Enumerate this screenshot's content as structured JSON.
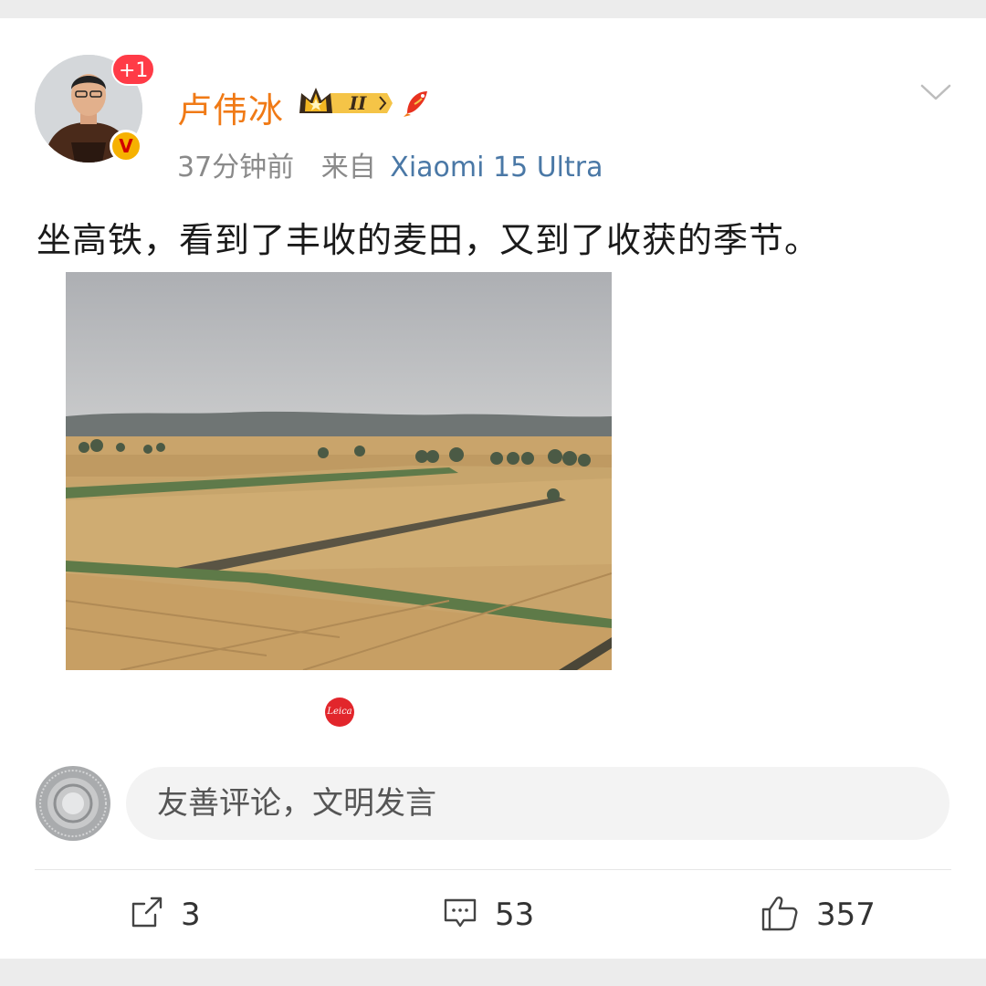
{
  "post": {
    "author": {
      "name": "卢伟冰",
      "notification_count": "+1",
      "verified_mark": "V",
      "level_badge": "II"
    },
    "time": "37分钟前",
    "source_prefix": "来自",
    "device": "Xiaomi 15 Ultra",
    "text": "坐高铁，看到了丰收的麦田，又到了收获的季节。",
    "photo_watermark": "Leica"
  },
  "comment_box": {
    "placeholder": "友善评论，文明发言"
  },
  "actions": {
    "share_count": "3",
    "comment_count": "53",
    "like_count": "357"
  },
  "colors": {
    "username": "#f07a16",
    "device_link": "#4a78a6",
    "notification_badge": "#ff3b47",
    "verified_badge": "#f6b100"
  },
  "icons": [
    "chevron-down-icon",
    "share-icon",
    "comment-icon",
    "like-icon",
    "crown-badge-icon",
    "koi-fish-icon"
  ]
}
